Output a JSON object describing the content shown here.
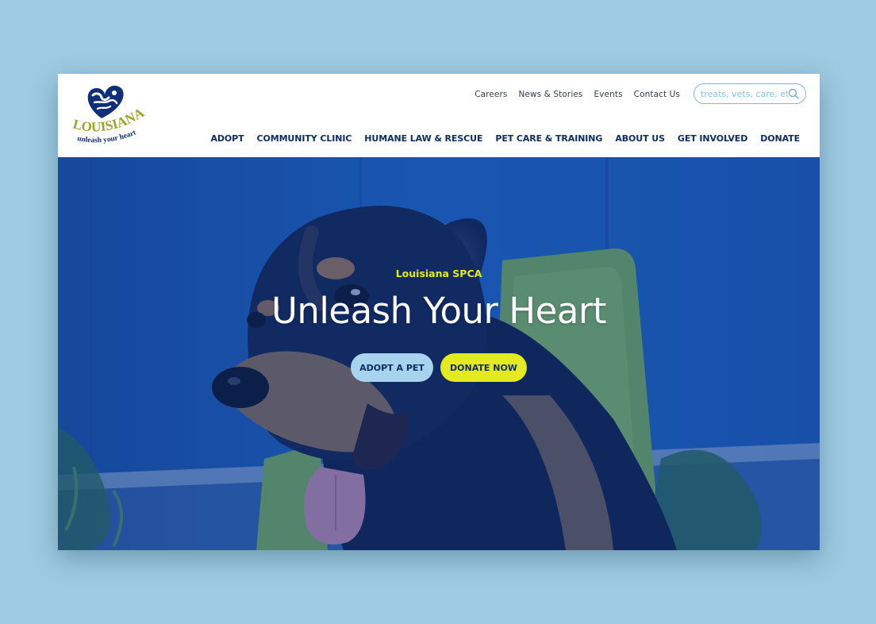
{
  "logo": {
    "name": "LOUISIANA SPCA",
    "tagline": "unleash your heart"
  },
  "utility_nav": [
    "Careers",
    "News & Stories",
    "Events",
    "Contact Us"
  ],
  "search": {
    "placeholder": "treats, vets, care, etc.",
    "icon": "search-icon"
  },
  "main_nav": [
    "ADOPT",
    "COMMUNITY CLINIC",
    "HUMANE LAW & RESCUE",
    "PET CARE & TRAINING",
    "ABOUT US",
    "GET INVOLVED",
    "DONATE"
  ],
  "hero": {
    "eyebrow": "Louisiana SPCA",
    "title": "Unleash Your Heart",
    "buttons": {
      "adopt": "ADOPT A PET",
      "donate": "DONATE NOW"
    }
  },
  "colors": {
    "page_background": "#9ecae2",
    "navy": "#0d2d63",
    "accent_yellow": "#e3ea1f",
    "light_blue": "#a7d3ee",
    "logo_green": "#9aa52a"
  }
}
